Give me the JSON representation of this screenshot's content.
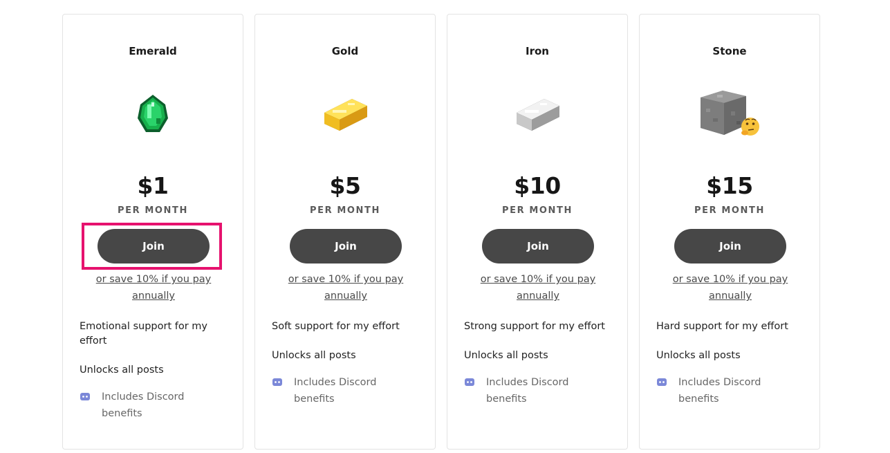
{
  "tiers": [
    {
      "name": "Emerald",
      "icon": "emerald-icon",
      "price": "$1",
      "period": "PER MONTH",
      "join_label": "Join",
      "annual_text": "or save 10% if you pay annually",
      "description": "Emotional support for my effort",
      "unlocks": "Unlocks all posts",
      "perk": "Includes Discord benefits"
    },
    {
      "name": "Gold",
      "icon": "gold-ingot-icon",
      "price": "$5",
      "period": "PER MONTH",
      "join_label": "Join",
      "annual_text": "or save 10% if you pay annually",
      "description": "Soft support for my effort",
      "unlocks": "Unlocks all posts",
      "perk": "Includes Discord benefits"
    },
    {
      "name": "Iron",
      "icon": "iron-ingot-icon",
      "price": "$10",
      "period": "PER MONTH",
      "join_label": "Join",
      "annual_text": "or save 10% if you pay annually",
      "description": "Strong support for my effort",
      "unlocks": "Unlocks all posts",
      "perk": "Includes Discord benefits"
    },
    {
      "name": "Stone",
      "icon": "stone-block-thinking-icon",
      "price": "$15",
      "period": "PER MONTH",
      "join_label": "Join",
      "annual_text": "or save 10% if you pay annually",
      "description": "Hard support for my effort",
      "unlocks": "Unlocks all posts",
      "perk": "Includes Discord benefits"
    }
  ],
  "colors": {
    "button": "#474747",
    "highlight": "#e6126e",
    "discord": "#7b88d8"
  }
}
